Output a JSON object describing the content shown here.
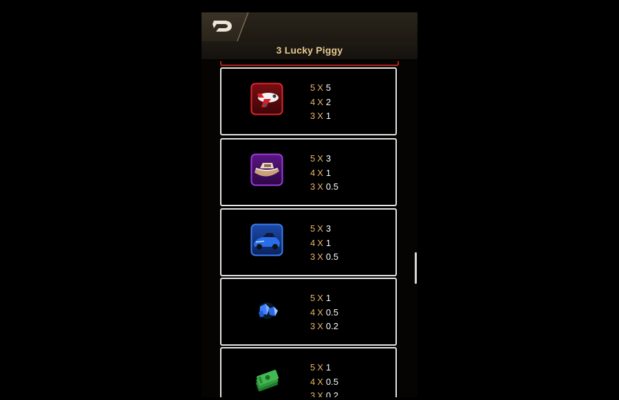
{
  "header": {
    "back_icon": "back-arrow-d-icon",
    "title": "3 Lucky Piggy"
  },
  "symbols": [
    {
      "icon": "airplane-icon",
      "frame_color": "#d3262b",
      "pays": [
        {
          "count": "5",
          "x": "X",
          "mult": "5"
        },
        {
          "count": "4",
          "x": "X",
          "mult": "2"
        },
        {
          "count": "3",
          "x": "X",
          "mult": "1"
        }
      ]
    },
    {
      "icon": "boat-icon",
      "frame_color": "#8e2ed6",
      "pays": [
        {
          "count": "5",
          "x": "X",
          "mult": "3"
        },
        {
          "count": "4",
          "x": "X",
          "mult": "1"
        },
        {
          "count": "3",
          "x": "X",
          "mult": "0.5"
        }
      ]
    },
    {
      "icon": "sports-car-icon",
      "frame_color": "#2f6fe6",
      "pays": [
        {
          "count": "5",
          "x": "X",
          "mult": "3"
        },
        {
          "count": "4",
          "x": "X",
          "mult": "1"
        },
        {
          "count": "3",
          "x": "X",
          "mult": "0.5"
        }
      ]
    },
    {
      "icon": "blue-gems-icon",
      "frame_color": "",
      "pays": [
        {
          "count": "5",
          "x": "X",
          "mult": "1"
        },
        {
          "count": "4",
          "x": "X",
          "mult": "0.5"
        },
        {
          "count": "3",
          "x": "X",
          "mult": "0.2"
        }
      ]
    },
    {
      "icon": "cash-stack-icon",
      "frame_color": "",
      "pays": [
        {
          "count": "5",
          "x": "X",
          "mult": "1"
        },
        {
          "count": "4",
          "x": "X",
          "mult": "0.5"
        },
        {
          "count": "3",
          "x": "X",
          "mult": "0.2"
        }
      ]
    }
  ],
  "colors": {
    "gold_text": "#e7b563",
    "title_text": "#e9c98f",
    "card_border": "#e6e6e6"
  }
}
